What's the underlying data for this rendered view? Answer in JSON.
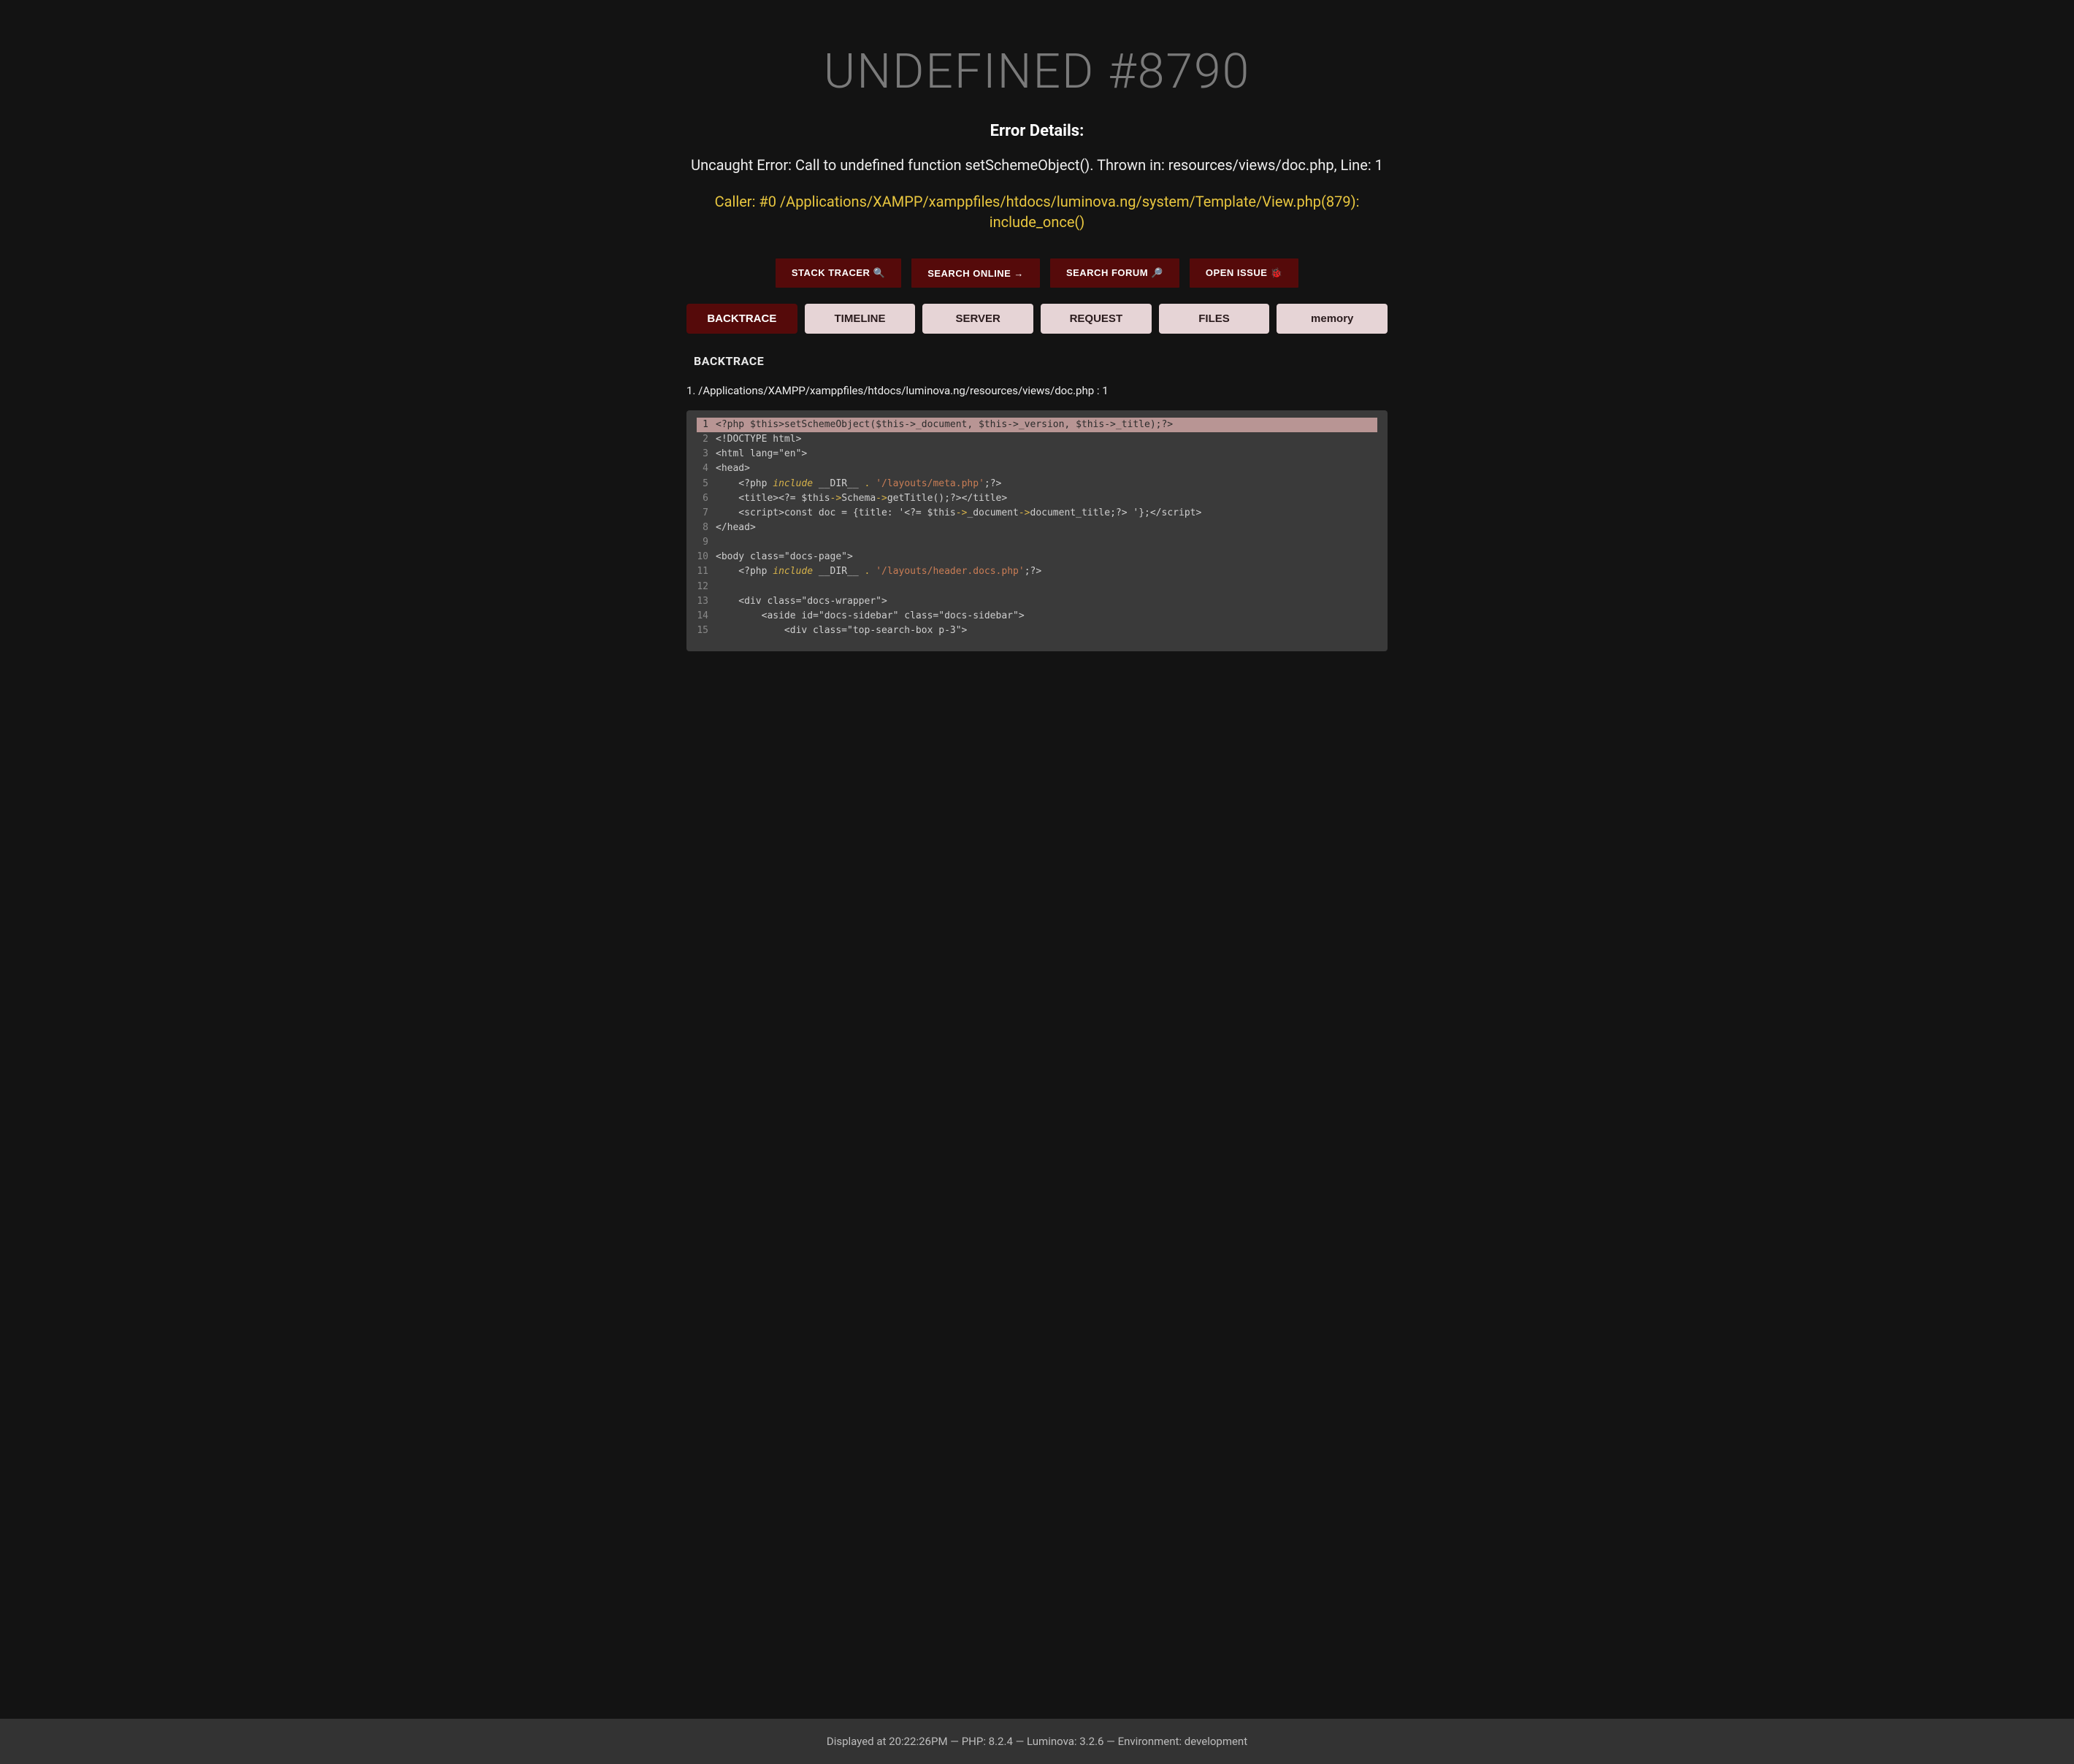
{
  "title": "UNDEFINED #8790",
  "subtitle": "Error Details:",
  "error_message": "Uncaught Error: Call to undefined function setSchemeObject(). Thrown in: resources/views/doc.php, Line: 1",
  "caller": "Caller: #0 /Applications/XAMPP/xamppfiles/htdocs/luminova.ng/system/Template/View.php(879): include_once()",
  "actions": {
    "stack_tracer": "STACK TRACER 🔍",
    "search_online": "SEARCH ONLINE →",
    "search_forum": "SEARCH FORUM 🔎",
    "open_issue": "OPEN ISSUE 🐞"
  },
  "tabs": {
    "backtrace": "BACKTRACE",
    "timeline": "TIMELINE",
    "server": "SERVER",
    "request": "REQUEST",
    "files": "FILES",
    "memory": "memory"
  },
  "section_heading": "BACKTRACE",
  "trace": {
    "index": "1.",
    "file": "/Applications/XAMPP/xamppfiles/htdocs/luminova.ng/resources/views/doc.php : 1"
  },
  "code": {
    "start_line": 1,
    "highlight_line": 1,
    "lines": [
      {
        "n": 1,
        "segs": [
          [
            "plain",
            "<?php $this>setSchemeObject($this->_document, $this->_version, $this->_title);?>"
          ]
        ]
      },
      {
        "n": 2,
        "segs": [
          [
            "plain",
            "<!DOCTYPE html>"
          ]
        ]
      },
      {
        "n": 3,
        "segs": [
          [
            "plain",
            "<html lang=\"en\">"
          ]
        ]
      },
      {
        "n": 4,
        "segs": [
          [
            "plain",
            "<head>"
          ]
        ]
      },
      {
        "n": 5,
        "segs": [
          [
            "plain",
            "    <?php "
          ],
          [
            "kw",
            "include"
          ],
          [
            "plain",
            " __DIR__ "
          ],
          [
            "op",
            "."
          ],
          [
            "plain",
            " "
          ],
          [
            "str",
            "'/layouts/meta.php'"
          ],
          [
            "plain",
            ";?>"
          ]
        ]
      },
      {
        "n": 6,
        "segs": [
          [
            "plain",
            "    <title><?= $this"
          ],
          [
            "op",
            "->"
          ],
          [
            "plain",
            "Schema"
          ],
          [
            "op",
            "->"
          ],
          [
            "plain",
            "getTitle();?></title>"
          ]
        ]
      },
      {
        "n": 7,
        "segs": [
          [
            "plain",
            "    <script>const doc = {title: '<?= $this"
          ],
          [
            "op",
            "->"
          ],
          [
            "plain",
            "_document"
          ],
          [
            "op",
            "->"
          ],
          [
            "plain",
            "document_title;?> '};</script>"
          ]
        ]
      },
      {
        "n": 8,
        "segs": [
          [
            "plain",
            "</head>"
          ]
        ]
      },
      {
        "n": 9,
        "segs": [
          [
            "plain",
            ""
          ]
        ]
      },
      {
        "n": 10,
        "segs": [
          [
            "plain",
            "<body class=\"docs-page\">"
          ]
        ]
      },
      {
        "n": 11,
        "segs": [
          [
            "plain",
            "    <?php "
          ],
          [
            "kw",
            "include"
          ],
          [
            "plain",
            " __DIR__ "
          ],
          [
            "op",
            "."
          ],
          [
            "plain",
            " "
          ],
          [
            "str",
            "'/layouts/header.docs.php'"
          ],
          [
            "plain",
            ";?>"
          ]
        ]
      },
      {
        "n": 12,
        "segs": [
          [
            "plain",
            ""
          ]
        ]
      },
      {
        "n": 13,
        "segs": [
          [
            "plain",
            "    <div class=\"docs-wrapper\">"
          ]
        ]
      },
      {
        "n": 14,
        "segs": [
          [
            "plain",
            "        <aside id=\"docs-sidebar\" class=\"docs-sidebar\">"
          ]
        ]
      },
      {
        "n": 15,
        "segs": [
          [
            "plain",
            "            <div class=\"top-search-box p-3\">"
          ]
        ]
      }
    ]
  },
  "footer": "Displayed at 20:22:26PM — PHP: 8.2.4 — Luminova: 3.2.6 — Environment: development"
}
